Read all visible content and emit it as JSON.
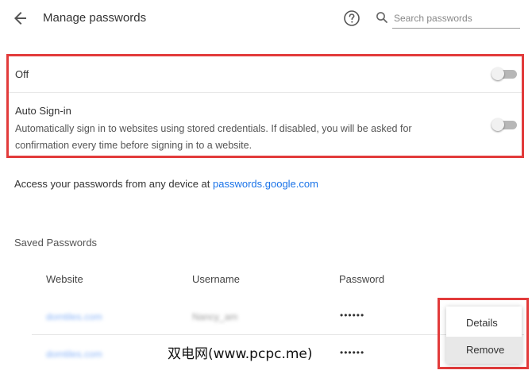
{
  "header": {
    "title": "Manage passwords",
    "search_placeholder": "Search passwords",
    "icons": {
      "back": "arrow-back-icon",
      "help": "help-circle-icon",
      "search": "search-icon"
    }
  },
  "settings": {
    "offer_to_save": {
      "label": "Off",
      "enabled": false
    },
    "auto_signin": {
      "title": "Auto Sign-in",
      "description": "Automatically sign in to websites using stored credentials. If disabled, you will be asked for confirmation every time before signing in to a website.",
      "enabled": false
    }
  },
  "access": {
    "prefix": "Access your passwords from any device at ",
    "link_text": "passwords.google.com"
  },
  "saved": {
    "heading": "Saved Passwords",
    "columns": [
      "Website",
      "Username",
      "Password"
    ],
    "rows": [
      {
        "website": "domtiles.com",
        "username": "Nancy_am",
        "password": "••••••"
      },
      {
        "website": "domtiles.com",
        "username": "",
        "password": "••••••"
      }
    ]
  },
  "context_menu": {
    "items": [
      "Details",
      "Remove"
    ],
    "highlighted": "Remove"
  },
  "watermark": "双电网(www.pcpc.me)",
  "colors": {
    "highlight_border": "#e23b3b",
    "link": "#1a73e8",
    "toggle_track": "#b7b7b7"
  }
}
